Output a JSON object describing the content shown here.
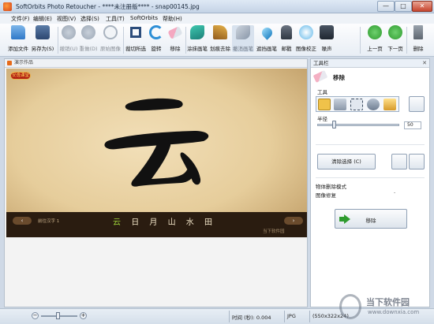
{
  "window": {
    "title": "SoftOrbits Photo Retoucher - ****未注册版**** - snap00145.jpg",
    "min": "—",
    "max": "□",
    "close": "✕"
  },
  "menu": [
    "文件(F)",
    "编辑(E)",
    "视图(V)",
    "选择(S)",
    "工具(T)",
    "SoftOrbits",
    "帮助(H)"
  ],
  "toolbar": {
    "open": "添加文件",
    "save_as": "另存为(S)",
    "undo": "撤销(U)",
    "redo": "重做(D)",
    "original": "原始图像",
    "crop": "裁切所选",
    "rotate": "旋转",
    "remove": "移除",
    "smear_brush": "涂抹画笔",
    "scratch_remove": "划痕去除",
    "stamp_brush": "撤消画笔",
    "retouch_brush": "遮挡画笔",
    "stamp": "邮戳",
    "image_correct": "图像校正",
    "noise": "噪声",
    "prev_page": "上一页",
    "next_page": "下一页",
    "delete": "删除"
  },
  "document": {
    "tab_label": "演示作品",
    "logo_badge": "安逸课堂",
    "prev_btn": "‹",
    "count_label": "前往汉字 1",
    "characters": [
      "云",
      "日",
      "月",
      "山",
      "水",
      "田"
    ],
    "next_btn": "›",
    "watermark": "当下软件园"
  },
  "tool_panel": {
    "header": "工具栏",
    "close": "✕",
    "title": "移除",
    "tools_label": "工具",
    "radius_label": "半径",
    "radius_value": "50",
    "radius_fraction": 0.2,
    "clear_button": "清除选择 (C)",
    "mode_label": "物体删除模式",
    "mode_value": "图像修复",
    "run_button": "移除"
  },
  "status": {
    "zoom_minus": "−",
    "zoom_plus": "+",
    "zoom_fraction": 0.45,
    "time": "时间 (秒): 0.004",
    "format": "JPG",
    "dimensions": "(550x322x24)"
  },
  "watermark": {
    "cn": "当下软件园",
    "url": "www.downxia.com"
  },
  "colors": {
    "accent_green": "#2e9b2e",
    "highlight_char": "#9fd23a",
    "brush_active": "#f0c24a"
  }
}
